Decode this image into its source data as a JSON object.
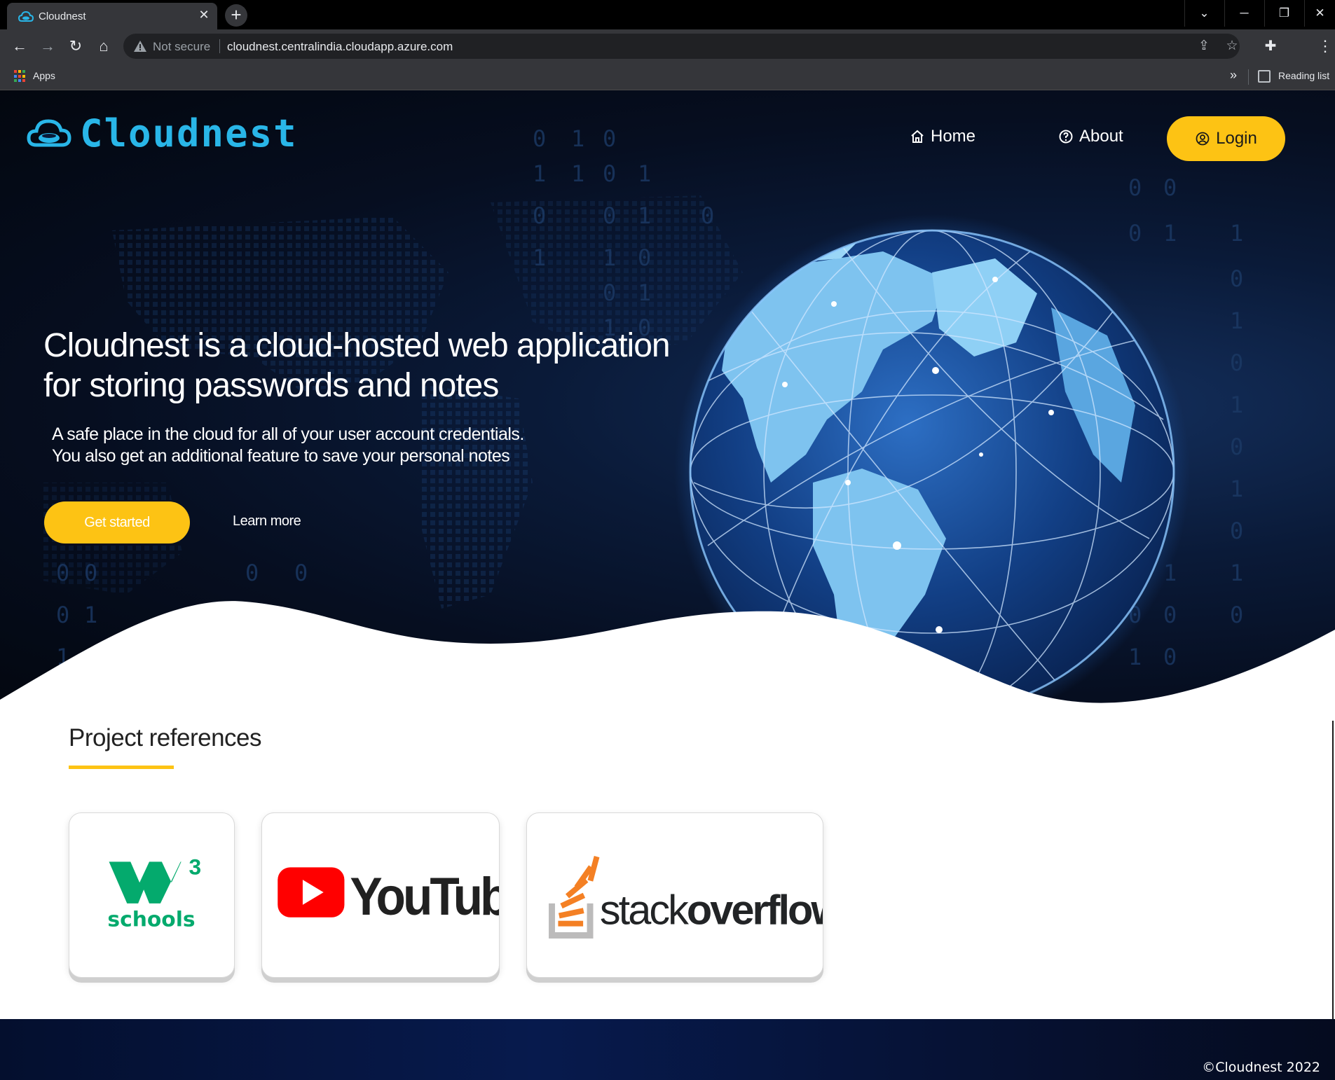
{
  "browser": {
    "tab_title": "Cloudnest",
    "new_tab_symbol": "+",
    "security_label": "Not secure",
    "url": "cloudnest.centralindia.cloudapp.azure.com",
    "bookmarks": {
      "apps_label": "Apps",
      "more_symbol": "»",
      "reading_list_label": "Reading list"
    }
  },
  "header": {
    "brand": "Cloudnest",
    "nav": {
      "home_label": "Home",
      "about_label": "About",
      "login_label": "Login"
    }
  },
  "hero": {
    "title": "Cloudnest is a cloud-hosted web application for storing passwords and notes",
    "subtitle_line1": "A safe place in the cloud for all of your user account credentials.",
    "subtitle_line2": "You also get an additional feature to save your personal notes",
    "primary_cta": "Get started",
    "secondary_cta": "Learn more"
  },
  "references": {
    "title": "Project references",
    "items": [
      {
        "name": "w3schools",
        "logo_text_1": "w",
        "logo_text_2": "3",
        "logo_text_3": "schools"
      },
      {
        "name": "YouTube",
        "logo_text": "YouTube"
      },
      {
        "name": "stackoverflow",
        "logo_text_1": "stack",
        "logo_text_2": "overflow"
      }
    ]
  },
  "footer": {
    "copyright": "©Cloudnest 2022"
  },
  "colors": {
    "accent": "#fdc314",
    "brand_blue": "#29b6e8",
    "w3_green": "#04aa6d",
    "youtube_red": "#ff0000",
    "so_orange": "#f48024",
    "hero_dark": "#060e20"
  },
  "icons": [
    "cloud-icon",
    "warning-icon",
    "home-icon",
    "help-circle-icon",
    "user-circle-icon",
    "puzzle-icon",
    "star-icon",
    "share-icon",
    "apps-grid-icon",
    "reading-list-icon",
    "globe-graphic"
  ]
}
